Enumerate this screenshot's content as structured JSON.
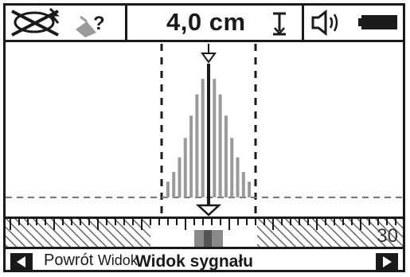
{
  "status_bar": {
    "measurement": "4,0 cm",
    "icons": [
      "no-cable-detection-icon",
      "unknown-material-icon",
      "depth-pointer-icon",
      "speaker-volume-icon",
      "battery-full-icon"
    ]
  },
  "scale": {
    "value_label": "30"
  },
  "bottom_bar": {
    "left_button_icon": "arrow-left-icon",
    "right_button_icon": "arrow-right-icon",
    "left_label": "Powrót",
    "left_label_overlap": "Widok",
    "center_label": "Widok sygnału"
  },
  "colors": {
    "ink": "#1a1a1a",
    "signal_bar": "#9a9a9a",
    "background": "#ffffff"
  }
}
